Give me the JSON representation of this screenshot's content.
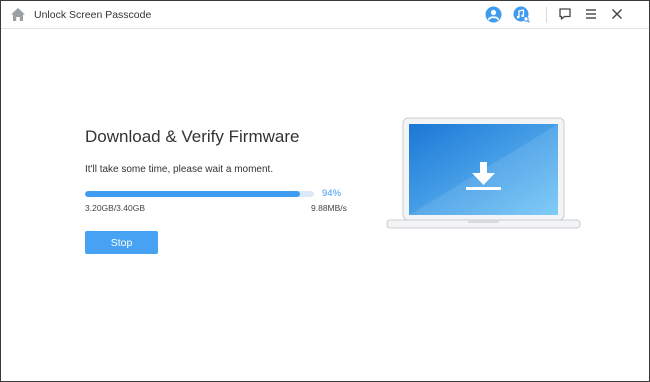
{
  "titlebar": {
    "title": "Unlock Screen Passcode",
    "icons": [
      "home-icon",
      "account-icon",
      "music-search-icon",
      "feedback-icon",
      "menu-icon",
      "close-icon"
    ]
  },
  "main": {
    "heading": "Download & Verify Firmware",
    "subtext": "It'll take some time, please wait a moment.",
    "progress": {
      "percent": 94,
      "percent_label": "94%",
      "size": "3.20GB/3.40GB",
      "speed": "9.88MB/s"
    },
    "stop_label": "Stop"
  },
  "colors": {
    "accent": "#3f9bf0",
    "button": "#47a2f3",
    "track": "#dbe8f7",
    "screen_top": "#1b77d6",
    "screen_bottom": "#72c6f7"
  }
}
